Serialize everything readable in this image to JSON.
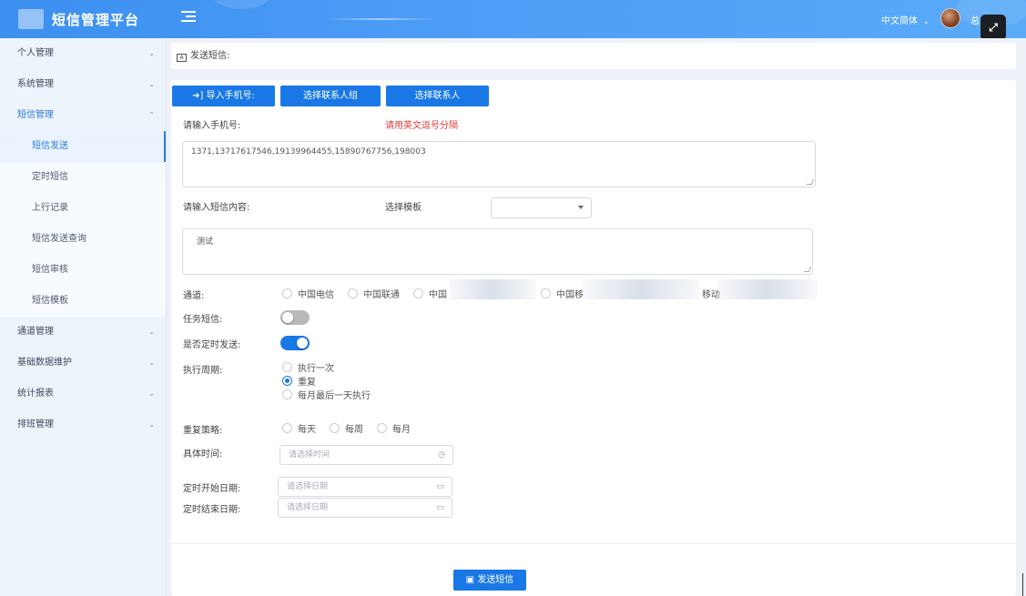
{
  "app": {
    "title": "短信管理平台",
    "language": "中文简体",
    "user": "总",
    "fullscreen_icon": "expand-icon"
  },
  "sidebar": {
    "items": [
      {
        "label": "个人管理"
      },
      {
        "label": "系统管理"
      },
      {
        "label": "短信管理",
        "children": [
          {
            "label": "短信发送"
          },
          {
            "label": "定时短信"
          },
          {
            "label": "上行记录"
          },
          {
            "label": "短信发送查询"
          },
          {
            "label": "短信审核"
          },
          {
            "label": "短信模板"
          }
        ]
      },
      {
        "label": "通道管理"
      },
      {
        "label": "基础数据维护"
      },
      {
        "label": "统计报表"
      },
      {
        "label": "排班管理"
      }
    ]
  },
  "breadcrumb": {
    "label": "发送短信:"
  },
  "form": {
    "import_btn": "导入手机号:",
    "group_btn": "选择联系人组",
    "contact_btn": "选择联系人",
    "phone_label": "请输入手机号:",
    "phone_hint": "请用英文逗号分隔",
    "phone_value": "1371,13717617546,19139964455,15890767756,198003",
    "content_label": "请输入短信内容:",
    "template_label": "选择模板",
    "content_value": "测试",
    "channel_label": "通道:",
    "channels": [
      "中国电信",
      "中国联通",
      "中国",
      "中国移",
      "移动"
    ],
    "task_label": "任务短信:",
    "timed_label": "是否定时发送:",
    "cycle_label": "执行周期:",
    "cycle_options": [
      "执行一次",
      "重复",
      "每月最后一天执行"
    ],
    "strategy_label": "重复策略:",
    "strategy_options": [
      "每天",
      "每周",
      "每月"
    ],
    "time_label": "具体时间:",
    "time_placeholder": "请选择时间",
    "start_label": "定时开始日期:",
    "end_label": "定时结束日期:",
    "date_placeholder": "请选择日期",
    "send_btn": "发送短信"
  }
}
